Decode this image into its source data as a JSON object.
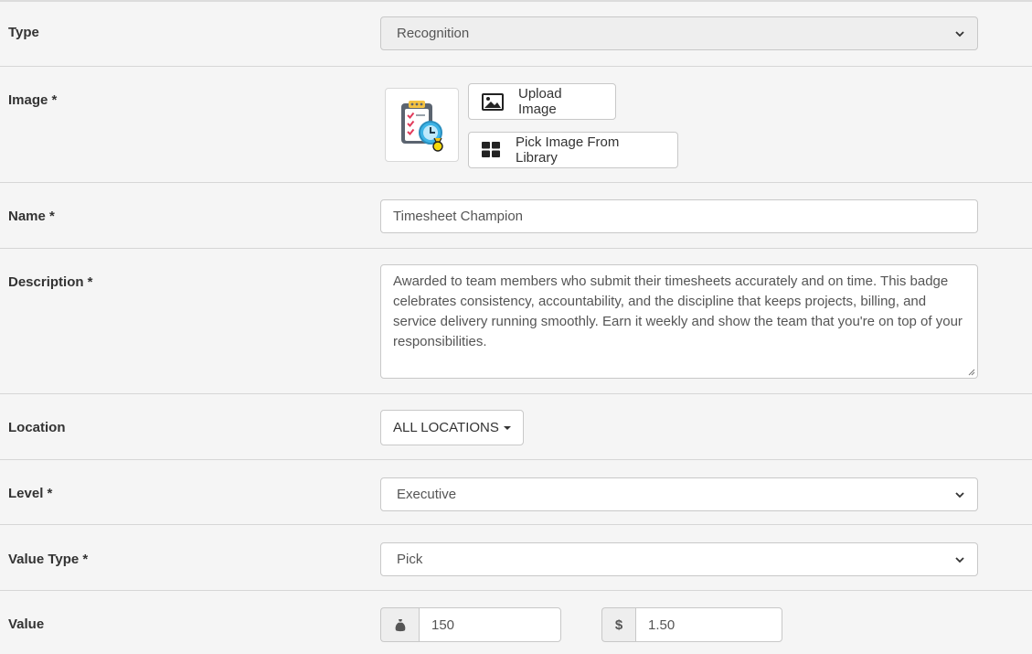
{
  "fields": {
    "type": {
      "label": "Type",
      "value": "Recognition"
    },
    "image": {
      "label": "Image *",
      "upload_label": "Upload Image",
      "library_label": "Pick Image From Library"
    },
    "name": {
      "label": "Name *",
      "value": "Timesheet Champion"
    },
    "description": {
      "label": "Description *",
      "value": "Awarded to team members who submit their timesheets accurately and on time. This badge celebrates consistency, accountability, and the discipline that keeps projects, billing, and service delivery running smoothly. Earn it weekly and show the team that you're on top of your responsibilities."
    },
    "location": {
      "label": "Location",
      "value": "ALL LOCATIONS"
    },
    "level": {
      "label": "Level *",
      "value": "Executive"
    },
    "value_type": {
      "label": "Value Type *",
      "value": "Pick"
    },
    "value": {
      "label": "Value",
      "points": "150",
      "currency_symbol": "$",
      "amount": "1.50"
    }
  },
  "icons": {
    "image_thumbnail": "clipboard-checklist-clock-medal-icon",
    "upload": "picture-icon",
    "library": "grid-icon",
    "points_addon": "money-bag-icon",
    "select_arrow": "chevron-down-icon"
  },
  "colors": {
    "background": "#f5f5f5",
    "border": "#c8c8c8",
    "disabled": "#eeeeee"
  }
}
